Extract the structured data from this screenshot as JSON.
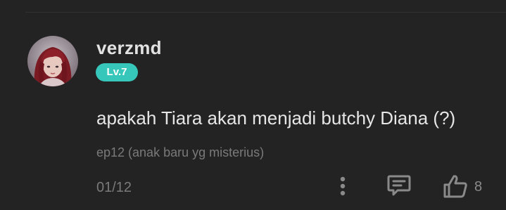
{
  "comment": {
    "username": "verzmd",
    "level": "Lv.7",
    "text": "apakah Tiara akan menjadi butchy Diana (?)",
    "episode": "ep12 (anak baru yg misterius)",
    "date": "01/12",
    "likes": "8"
  },
  "icons": {
    "avatar": "user-avatar",
    "more": "vertical-ellipsis-icon",
    "reply": "chat-bubble-icon",
    "like": "thumbs-up-icon"
  },
  "colors": {
    "background": "#232323",
    "level_badge": "#37c7ba",
    "muted_text": "#7a7a7a",
    "primary_text": "#e6e6e6"
  }
}
